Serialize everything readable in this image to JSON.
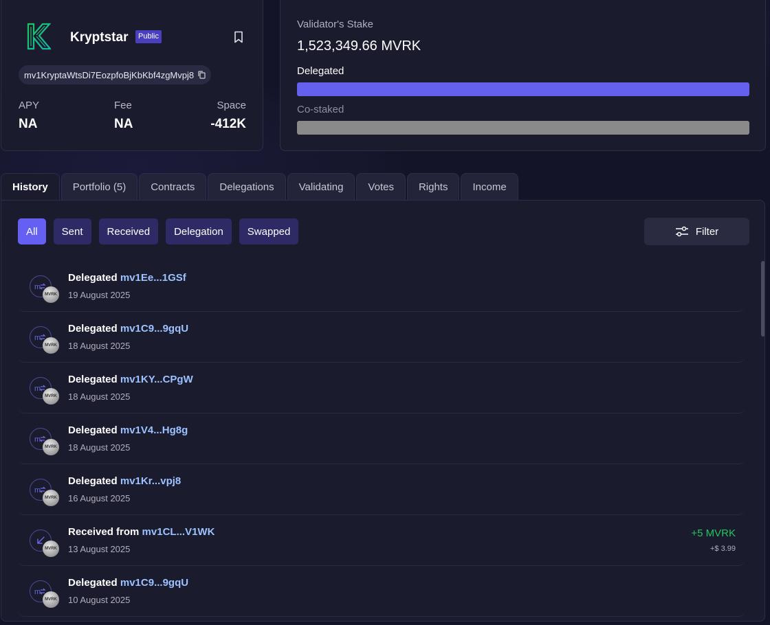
{
  "validator": {
    "name": "Kryptstar",
    "badge": "Public",
    "address": "mv1KryptaWtsDi7EozpfoBjKbKbf4zgMvpj8",
    "stats": [
      {
        "label": "APY",
        "value": "NA"
      },
      {
        "label": "Fee",
        "value": "NA"
      },
      {
        "label": "Space",
        "value": "-412K"
      }
    ]
  },
  "stake": {
    "title": "Validator's Stake",
    "amount": "1,523,349.66 MVRK",
    "delegated_label": "Delegated",
    "delegated_fraction": 1.0,
    "delegated_color": "#6361ee",
    "costaked_label": "Co-staked",
    "costaked_fraction": 1.0,
    "costaked_color": "#8a8a8a"
  },
  "tabs": [
    {
      "label": "History",
      "active": true
    },
    {
      "label": "Portfolio (5)"
    },
    {
      "label": "Contracts"
    },
    {
      "label": "Delegations"
    },
    {
      "label": "Validating"
    },
    {
      "label": "Votes"
    },
    {
      "label": "Rights"
    },
    {
      "label": "Income"
    }
  ],
  "filters": {
    "chips": [
      {
        "label": "All",
        "active": true
      },
      {
        "label": "Sent"
      },
      {
        "label": "Received"
      },
      {
        "label": "Delegation"
      },
      {
        "label": "Swapped"
      }
    ],
    "filter_button": "Filter"
  },
  "transactions": [
    {
      "type": "delegate",
      "action": "Delegated",
      "address": "mv1Ee...1GSf",
      "date": "19 August 2025",
      "token": "MVRK"
    },
    {
      "type": "delegate",
      "action": "Delegated",
      "address": "mv1C9...9gqU",
      "date": "18 August 2025",
      "token": "MVRK"
    },
    {
      "type": "delegate",
      "action": "Delegated",
      "address": "mv1KY...CPgW",
      "date": "18 August 2025",
      "token": "MVRK"
    },
    {
      "type": "delegate",
      "action": "Delegated",
      "address": "mv1V4...Hg8g",
      "date": "18 August 2025",
      "token": "MVRK"
    },
    {
      "type": "delegate",
      "action": "Delegated",
      "address": "mv1Kr...vpj8",
      "date": "16 August 2025",
      "token": "MVRK"
    },
    {
      "type": "receive",
      "action": "Received from",
      "address": "mv1CL...V1WK",
      "date": "13 August 2025",
      "token": "MVRK",
      "amount": "+5 MVRK",
      "usd": "+$ 3.99"
    },
    {
      "type": "delegate",
      "action": "Delegated",
      "address": "mv1C9...9gqU",
      "date": "10 August 2025",
      "token": "MVRK"
    }
  ],
  "colors": {
    "accent": "#6560f2",
    "positive": "#22c55e",
    "address_link": "#9cc2ff"
  }
}
